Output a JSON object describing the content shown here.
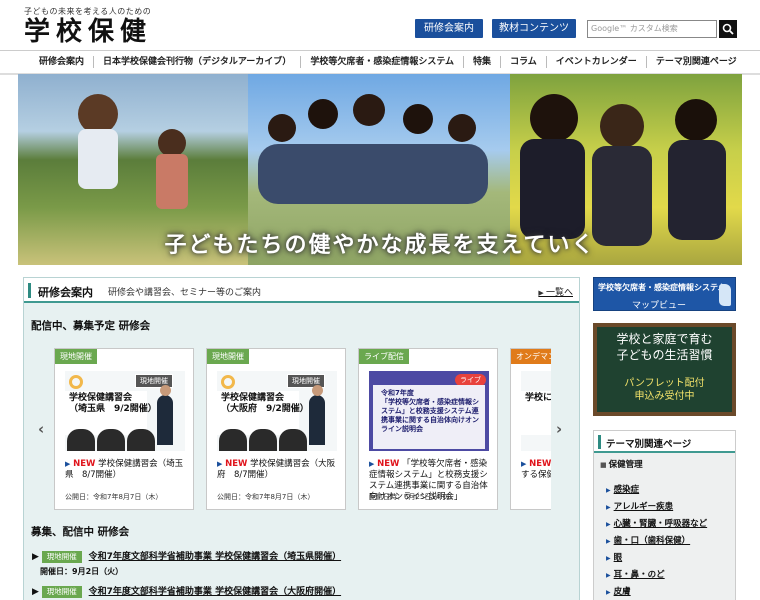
{
  "header": {
    "tagline": "子どもの未来を考える人のための",
    "logo": "学校保健",
    "buttons": [
      "研修会案内",
      "教材コンテンツ"
    ],
    "search_placeholder": "Google™ カスタム検索"
  },
  "nav": [
    "研修会案内",
    "日本学校保健会刊行物（デジタルアーカイブ）",
    "学校等欠席者・感染症情報システム",
    "特集",
    "コラム",
    "イベントカレンダー",
    "テーマ別関連ページ"
  ],
  "hero": {
    "tagline": "子どもたちの健やかな成長を支えていく"
  },
  "training": {
    "title": "研修会案内",
    "subtitle": "研修会や講習会、セミナー等のご案内",
    "more": "一覧へ",
    "section1": "配信中、募集予定 研修会",
    "cards": [
      {
        "tag": "現地開催",
        "badge": "現地開催",
        "img_title_1": "学校保健講習会",
        "img_title_2": "（埼玉県　9/2開催）",
        "new": "NEW",
        "title": "学校保健講習会（埼玉県　8/7開催）",
        "date": "公開日：令和7年8月7日（木）"
      },
      {
        "tag": "現地開催",
        "badge": "現地開催",
        "img_title_1": "学校保健講習会",
        "img_title_2": "（大阪府　9/2開催）",
        "new": "NEW",
        "title": "学校保健講習会（大阪府　8/7開催）",
        "date": "公開日：令和7年8月7日（木）"
      },
      {
        "tag": "ライブ配信",
        "badge": "ライブ",
        "img_title_1": "令和7年度",
        "img_title_2": "「学校等欠席者・感染症情報システム」と校務支援システム連携事業に関する自治体向けオンライン説明会",
        "new": "NEW",
        "title": "「学校等欠席者・感染症情報システム」と校務支援システム連携事業に関する自治体向けオンライン説明会」",
        "date": "配信日時：6月25日14:00"
      },
      {
        "tag": "オンデマンド",
        "badge": "",
        "img_title_1": "学校に",
        "img_title_2": "",
        "new": "NEW",
        "title": "する保健",
        "date": ""
      }
    ],
    "section2": "募集、配信中 研修会",
    "list": [
      {
        "badge": "現地開催",
        "title": "令和7年度文部科学省補助事業 学校保健講習会（埼玉県開催）",
        "date": "開催日：9月2日（火）"
      },
      {
        "badge": "現地開催",
        "title": "令和7年度文部科学省補助事業 学校保健講習会（大阪府開催）",
        "date": ""
      }
    ]
  },
  "sidebar": {
    "map_title": "学校等欠席者・感染症情報システム",
    "map_label": "マップビュー",
    "board_line1": "学校と家庭で育む",
    "board_line2": "子どもの生活習慣",
    "board_line3": "パンフレット配付",
    "board_line4": "申込み受付中",
    "theme_title": "テーマ別関連ページ",
    "theme_category": "保健管理",
    "theme_links": [
      "感染症",
      "アレルギー疾患",
      "心臓・腎臓・呼吸器など",
      "歯・口（歯科保健）",
      "眼",
      "耳・鼻・のど",
      "皮膚"
    ]
  },
  "colors": {
    "accent": "#1a4f9c",
    "teal": "#3f9a91",
    "new": "#e0141c",
    "onsite": "#6aa84f"
  }
}
